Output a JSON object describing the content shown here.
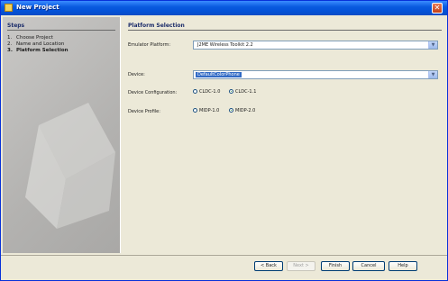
{
  "window": {
    "title": "New Project"
  },
  "steps": {
    "heading": "Steps",
    "items": [
      {
        "num": "1.",
        "label": "Choose Project"
      },
      {
        "num": "2.",
        "label": "Name and Location"
      },
      {
        "num": "3.",
        "label": "Platform Selection"
      }
    ]
  },
  "main": {
    "title": "Platform Selection",
    "emulator_platform": {
      "label": "Emulator Platform:",
      "value": "J2ME Wireless Toolkit 2.2"
    },
    "device": {
      "label": "Device:",
      "value": "DefaultColorPhone"
    },
    "device_configuration": {
      "label": "Device Configuration:",
      "options": [
        {
          "label": "CLDC-1.0",
          "selected": false
        },
        {
          "label": "CLDC-1.1",
          "selected": true
        }
      ]
    },
    "device_profile": {
      "label": "Device Profile:",
      "options": [
        {
          "label": "MIDP-1.0",
          "selected": false
        },
        {
          "label": "MIDP-2.0",
          "selected": true
        }
      ]
    }
  },
  "buttons": {
    "back": "< Back",
    "next": "Next >",
    "finish": "Finish",
    "cancel": "Cancel",
    "help": "Help"
  },
  "colors": {
    "titlebar": "#0A5BE0",
    "selection": "#316AC5",
    "heading": "#1B2C6A"
  }
}
